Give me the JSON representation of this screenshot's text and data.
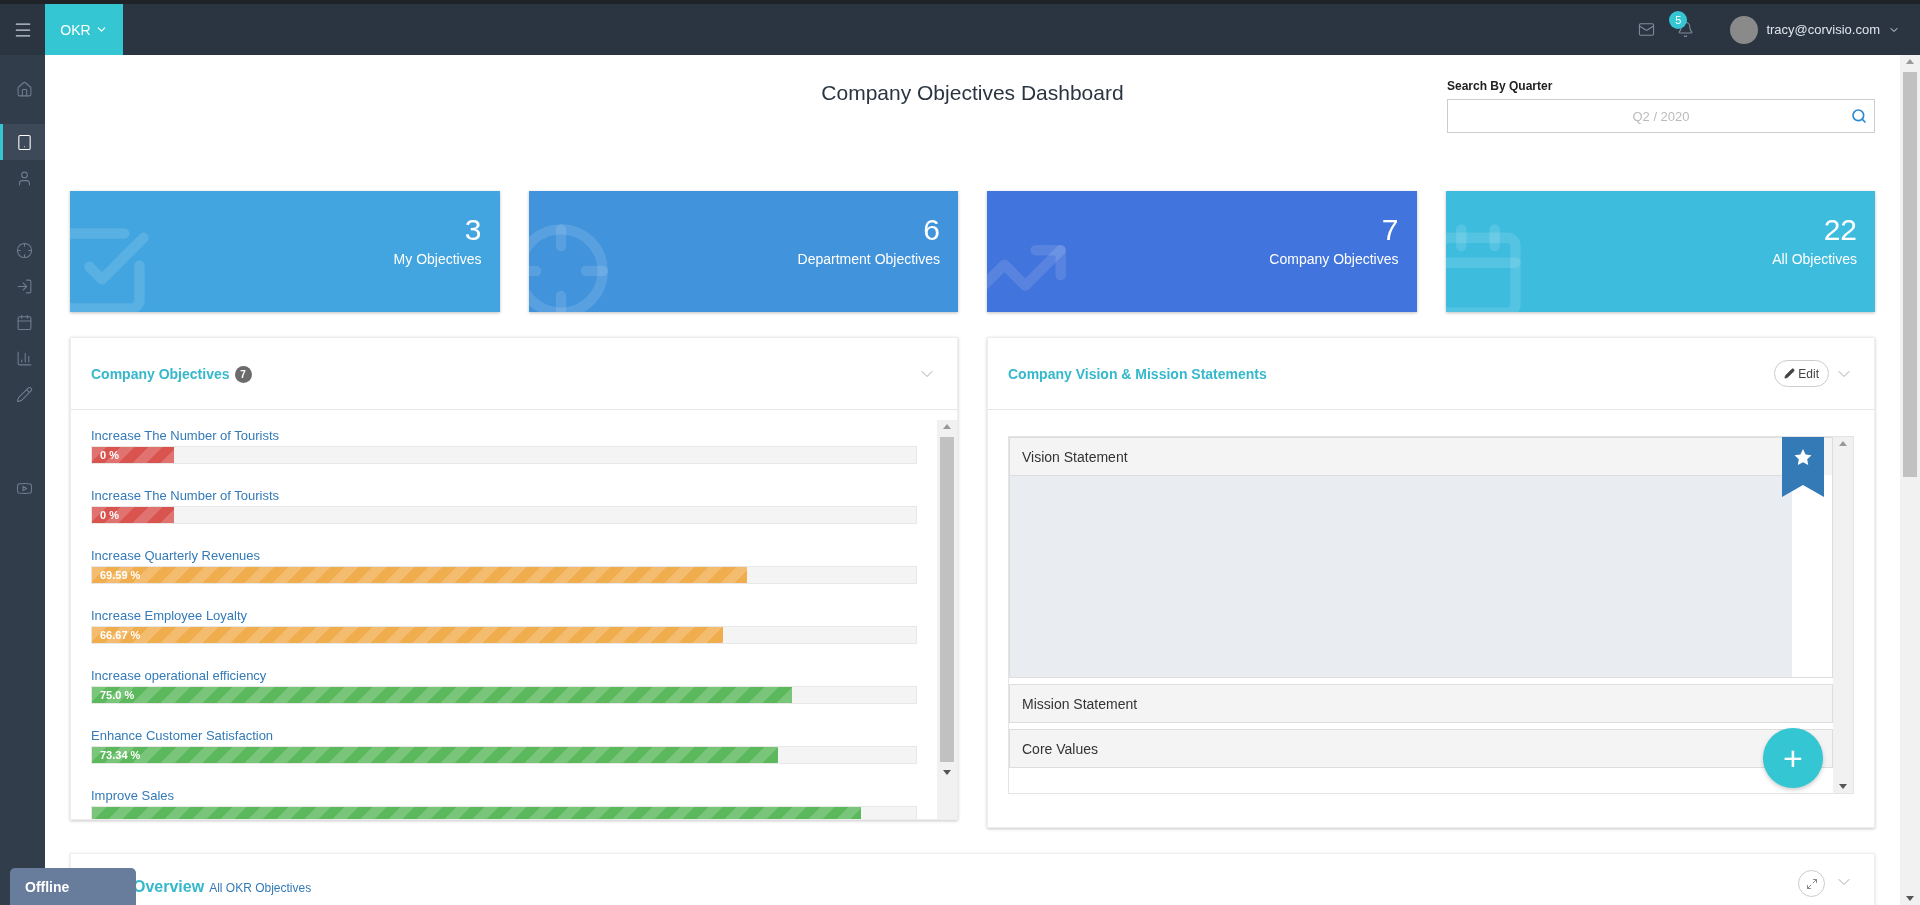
{
  "topbar": {
    "app_menu": "OKR",
    "notifications": "5",
    "user_email": "tracy@corvisio.com"
  },
  "sidebar": {
    "items": [
      {
        "selected": false
      },
      {
        "selected": true
      },
      {
        "selected": false
      },
      {
        "selected": false
      },
      {
        "selected": false
      },
      {
        "selected": false
      },
      {
        "selected": false
      },
      {
        "selected": false
      },
      {
        "selected": false
      }
    ]
  },
  "page_title": "Company Objectives Dashboard",
  "search": {
    "label": "Search By Quarter",
    "placeholder": "Q2 / 2020"
  },
  "stat_cards": [
    {
      "value": "3",
      "label": "My Objectives",
      "color": "#42a5df"
    },
    {
      "value": "6",
      "label": "Department Objectives",
      "color": "#4193dc"
    },
    {
      "value": "7",
      "label": "Company Objectives",
      "color": "#4174dc"
    },
    {
      "value": "22",
      "label": "All Objectives",
      "color": "#3ebcde"
    }
  ],
  "objectives": {
    "title": "Company Objectives",
    "count": "7",
    "items": [
      {
        "name": "Increase The Number of Tourists",
        "value": "0 %",
        "level": 0.1,
        "color": "#d9534f"
      },
      {
        "name": "Increase The Number of Tourists",
        "value": "0 %",
        "level": 0.1,
        "color": "#d9534f"
      },
      {
        "name": "Increase Quarterly Revenues",
        "value": "69.59 %",
        "level": 0.795,
        "color": "#f0ad4e"
      },
      {
        "name": "Increase Employee Loyalty",
        "value": "66.67 %",
        "level": 0.766,
        "color": "#f0ad4e"
      },
      {
        "name": "Increase operational efficiency",
        "value": "75.0 %",
        "level": 0.85,
        "color": "#5cb85c"
      },
      {
        "name": "Enhance Customer Satisfaction",
        "value": "73.34 %",
        "level": 0.833,
        "color": "#5cb85c"
      },
      {
        "name": "Improve Sales",
        "level": 0.933,
        "color": "#5cb85c"
      }
    ]
  },
  "vision": {
    "title": "Company Vision & Mission Statements",
    "edit": "Edit",
    "sections": [
      {
        "title": "Vision Statement",
        "expanded": true
      },
      {
        "title": "Mission Statement",
        "expanded": false
      },
      {
        "title": "Core Values",
        "expanded": false
      }
    ],
    "add_button": "+"
  },
  "overview": {
    "title": "Overview",
    "subtitle": "All OKR Objectives"
  },
  "status_badge": "Offline"
}
